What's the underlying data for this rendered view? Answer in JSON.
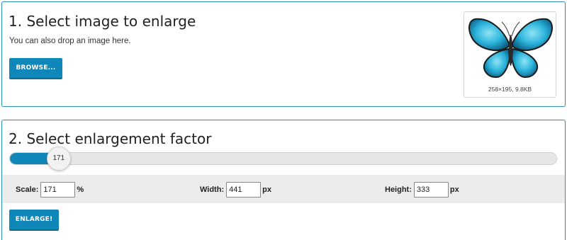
{
  "section1": {
    "title": "1. Select image to enlarge",
    "subtitle": "You can also drop an image here.",
    "browse_label": "BROWSE...",
    "thumbnail": {
      "caption": "258×195, 9.8KB",
      "icon": "butterfly-image"
    }
  },
  "section2": {
    "title": "2. Select enlargement factor",
    "slider": {
      "value": "171",
      "level": 0.068
    },
    "scale": {
      "label": "Scale:",
      "value": "171",
      "unit": "%"
    },
    "width": {
      "label": "Width:",
      "value": "441",
      "unit": "px"
    },
    "height": {
      "label": "Height:",
      "value": "333",
      "unit": "px"
    },
    "enlarge_label": "ENLARGE!"
  },
  "colors": {
    "accent": "#0f87b8",
    "border": "#2a8fb0",
    "bar_bg": "#ececec"
  }
}
